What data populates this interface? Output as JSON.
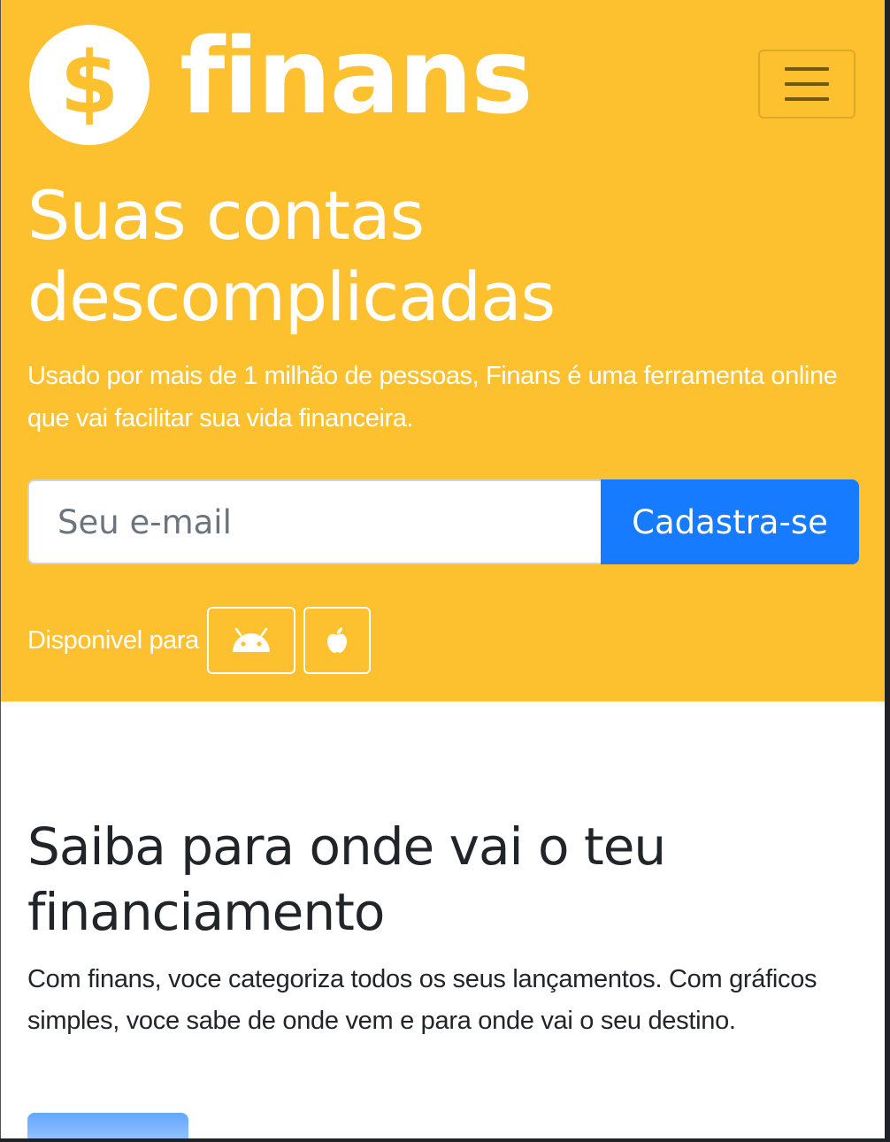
{
  "header": {
    "brand_symbol": "$",
    "brand_name": "finans",
    "menu_icon": "hamburger-menu-icon"
  },
  "hero": {
    "title": "Suas contas descomplicadas",
    "lead": "Usado por mais de 1 milhão de pessoas, Finans é uma ferramenta online que vai facilitar sua vida financeira.",
    "email_placeholder": "Seu e-mail",
    "email_value": "",
    "signup_label": "Cadastra-se",
    "available_label": "Disponivel para",
    "store_icons": [
      "android-icon",
      "apple-icon"
    ]
  },
  "features": {
    "title": "Saiba para onde vai o teu financiamento",
    "text": "Com finans, voce categoriza todos os seus lançamentos. Com gráficos simples, voce sabe de onde vem e para onde vai o seu destino."
  },
  "colors": {
    "hero_background": "#fdc02f",
    "primary_button": "#167bff",
    "heading_text": "#212529"
  }
}
